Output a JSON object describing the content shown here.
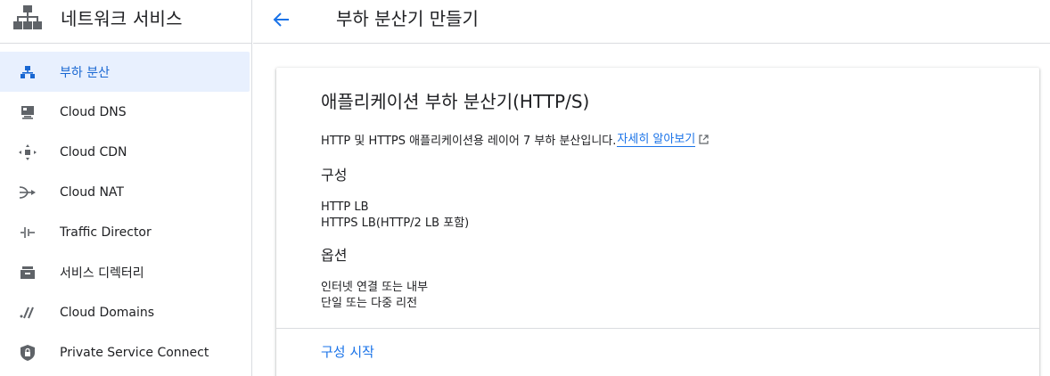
{
  "sidebar": {
    "title": "네트워크 서비스",
    "items": [
      {
        "label": "부하 분산",
        "icon": "load-balancing-icon",
        "active": true
      },
      {
        "label": "Cloud DNS",
        "icon": "dns-icon",
        "active": false
      },
      {
        "label": "Cloud CDN",
        "icon": "cdn-icon",
        "active": false
      },
      {
        "label": "Cloud NAT",
        "icon": "nat-icon",
        "active": false
      },
      {
        "label": "Traffic Director",
        "icon": "traffic-director-icon",
        "active": false
      },
      {
        "label": "서비스 디렉터리",
        "icon": "service-directory-icon",
        "active": false
      },
      {
        "label": "Cloud Domains",
        "icon": "domains-icon",
        "active": false
      },
      {
        "label": "Private Service Connect",
        "icon": "shield-lock-icon",
        "active": false
      }
    ]
  },
  "header": {
    "title": "부하 분산기 만들기"
  },
  "card": {
    "title": "애플리케이션 부하 분산기(HTTP/S)",
    "description": "HTTP 및 HTTPS 애플리케이션용 레이어 7 부하 분산입니다.",
    "learn_more": "자세히 알아보기",
    "config_heading": "구성",
    "config_lines": [
      "HTTP LB",
      "HTTPS LB(HTTP/2 LB 포함)"
    ],
    "options_heading": "옵션",
    "options_lines": [
      "인터넷 연결 또는 내부",
      "단일 또는 다중 리전"
    ],
    "start_button": "구성 시작"
  },
  "colors": {
    "accent": "#1a73e8",
    "active_bg": "#e8f0fe",
    "icon_gray": "#5f6368"
  }
}
